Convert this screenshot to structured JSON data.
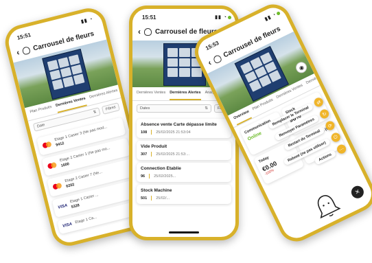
{
  "app": {
    "title": "Carrousel de fleurs",
    "brand_color": "#d8b12a",
    "online_color": "#6dbb2a"
  },
  "left": {
    "time": "15:51",
    "tabs": [
      "Plan Produits",
      "Dernières Ventes",
      "Dernières Alertes"
    ],
    "filter_date": "Date",
    "filter_label": "Filtres",
    "sales": [
      {
        "card": "mastercard",
        "line": "Etage 1 Casier 3 (Ne pas mod...",
        "ref": "9412"
      },
      {
        "card": "mastercard",
        "line": "Etage 2 Casier 1 (Ne pas mo...",
        "ref": "1600"
      },
      {
        "card": "mastercard",
        "line": "Etage 2 Casier 7 (Ne...",
        "ref": "6202"
      },
      {
        "card": "visa",
        "line": "Etage 1 Casier ...",
        "ref": "5328"
      },
      {
        "card": "visa",
        "line": "Etage 1 Ca...",
        "ref": ""
      }
    ]
  },
  "center": {
    "time": "15:51",
    "tabs": [
      "Dernières Ventes",
      "Dernières Alertes",
      "Analyses"
    ],
    "filter_date": "Dates",
    "filter_label": "Filtres",
    "alerts": [
      {
        "title": "Absence vente Carte dépasse limite",
        "num": "108",
        "date": "25/02/2025 21:53:04"
      },
      {
        "title": "Vide Produit",
        "num": "307",
        "date": "25/02/2025 21:53:..."
      },
      {
        "title": "Connection Établie",
        "num": "96",
        "date": "25/02/2025..."
      },
      {
        "title": "Stock Machine",
        "num": "501",
        "date": "25/02/..."
      }
    ]
  },
  "right": {
    "time": "15:53",
    "tabs": [
      "Overview",
      "Plan Produits",
      "Dernières Ventes",
      "Dernière..."
    ],
    "communication_label": "Communication",
    "online_label": "Online",
    "stock_label": "Stock",
    "stock_value": "96%",
    "today_label": "Today",
    "today_value": "€0.00",
    "today_change": "-100%",
    "alerts_label": "Alertes Actives (0)",
    "actions": [
      {
        "label": "Remplacer le Terminal",
        "icon": "swap-icon"
      },
      {
        "label": "Renvoyer Paramètres",
        "icon": "refresh-icon"
      },
      {
        "label": "Restart du Terminal",
        "icon": "restart-icon"
      },
      {
        "label": "Reboot (ne pas utiliser)",
        "icon": "reboot-icon"
      },
      {
        "label": "Actions",
        "icon": "menu-icon"
      }
    ]
  }
}
